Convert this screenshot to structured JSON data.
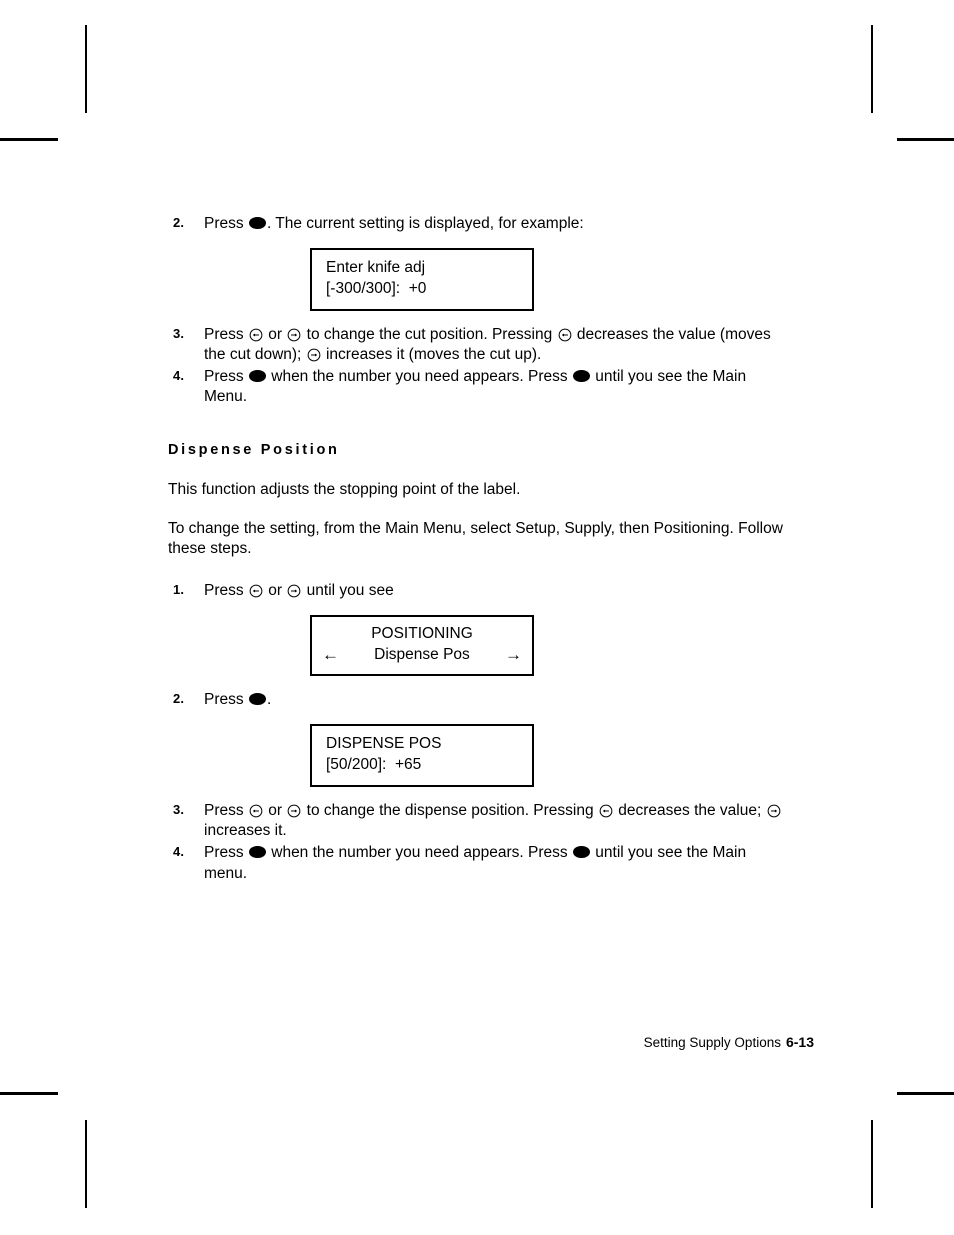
{
  "page": {
    "footer_title": "Setting Supply Options",
    "page_number": "6-13"
  },
  "icons": {
    "enter_key": "filled-ellipse-enter-key",
    "left_arrow_key": "circled-left-arrow-key",
    "right_arrow_key": "circled-right-arrow-key",
    "lcd_left_arrow": "left-arrow",
    "lcd_right_arrow": "right-arrow"
  },
  "knife_adj_section": {
    "step2": {
      "number": "2.",
      "text_before": "Press",
      "text_after": ".  The current setting is displayed, for example:"
    },
    "display": {
      "line1": "Enter knife adj",
      "line2": "[-300/300]:  +0"
    },
    "step3": {
      "number": "3.",
      "t1": "Press",
      "t2": "or",
      "t3": "to change the cut position.  Pressing",
      "t4": "decreases the value (moves the cut down);",
      "t5": "increases it (moves the cut up)."
    },
    "step4": {
      "number": "4.",
      "t1": "Press",
      "t2": "when the number you need appears.  Press",
      "t3": "until you see the Main Menu."
    }
  },
  "dispense_position_section": {
    "heading": "Dispense Position",
    "intro": "This function adjusts the stopping point of the label.",
    "navigation": "To change the setting, from the Main Menu, select Setup, Supply, then Positioning.  Follow these steps.",
    "step1": {
      "number": "1.",
      "t1": "Press",
      "t2": "or",
      "t3": "until you see"
    },
    "positioning_display": {
      "title": "POSITIONING",
      "option": "Dispense Pos",
      "left_arrow": "←",
      "right_arrow": "→"
    },
    "step2": {
      "number": "2.",
      "t1": "Press",
      "t2": "."
    },
    "dispense_display": {
      "line1": "DISPENSE POS",
      "line2": "[50/200]:  +65"
    },
    "step3": {
      "number": "3.",
      "t1": "Press",
      "t2": "or",
      "t3": "to change the dispense position.  Pressing",
      "t4": "decreases the value;",
      "t5": "increases it."
    },
    "step4": {
      "number": "4.",
      "t1": "Press",
      "t2": "when the number you need appears.  Press",
      "t3": "until you see the Main menu."
    }
  },
  "colors": {
    "ink": "#000000",
    "paper": "#ffffff"
  }
}
